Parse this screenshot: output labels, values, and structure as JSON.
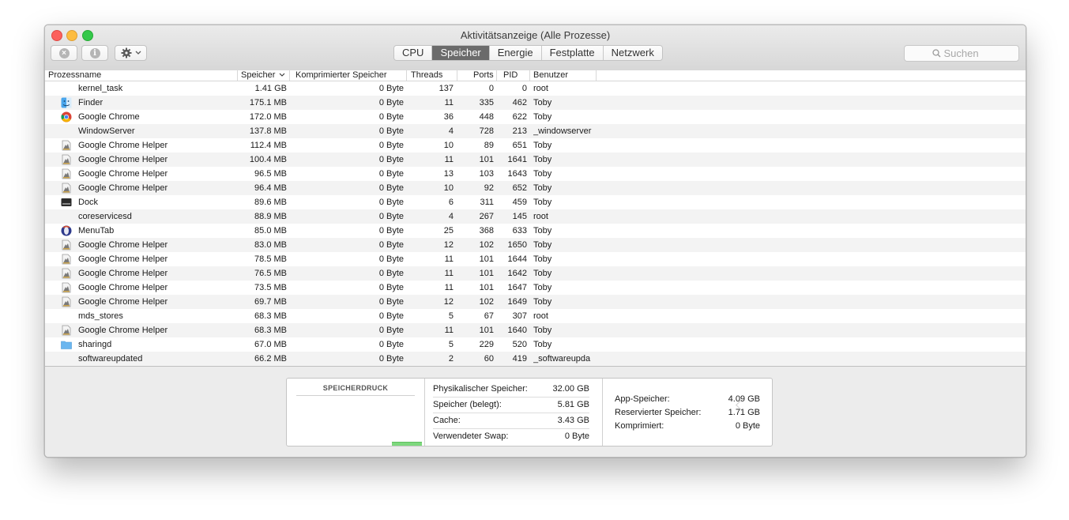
{
  "window": {
    "title": "Aktivitätsanzeige (Alle Prozesse)"
  },
  "toolbar": {
    "stop_icon": "stop-icon",
    "info_icon": "info-icon",
    "gear_icon": "gear-icon",
    "tabs": [
      {
        "label": "CPU",
        "active": false
      },
      {
        "label": "Speicher",
        "active": true
      },
      {
        "label": "Energie",
        "active": false
      },
      {
        "label": "Festplatte",
        "active": false
      },
      {
        "label": "Netzwerk",
        "active": false
      }
    ],
    "search_placeholder": "Suchen"
  },
  "table": {
    "columns": {
      "name": "Prozessname",
      "memory": "Speicher",
      "compressed": "Komprimierter Speicher",
      "threads": "Threads",
      "ports": "Ports",
      "pid": "PID",
      "user": "Benutzer"
    },
    "rows": [
      {
        "name": "kernel_task",
        "memory": "1.41 GB",
        "compressed": "0 Byte",
        "threads": "137",
        "ports": "0",
        "pid": "0",
        "user": "root",
        "icon": "none"
      },
      {
        "name": "Finder",
        "memory": "175.1 MB",
        "compressed": "0 Byte",
        "threads": "11",
        "ports": "335",
        "pid": "462",
        "user": "Toby",
        "icon": "finder"
      },
      {
        "name": "Google Chrome",
        "memory": "172.0 MB",
        "compressed": "0 Byte",
        "threads": "36",
        "ports": "448",
        "pid": "622",
        "user": "Toby",
        "icon": "chrome"
      },
      {
        "name": "WindowServer",
        "memory": "137.8 MB",
        "compressed": "0 Byte",
        "threads": "4",
        "ports": "728",
        "pid": "213",
        "user": "_windowserver",
        "icon": "none"
      },
      {
        "name": "Google Chrome Helper",
        "memory": "112.4 MB",
        "compressed": "0 Byte",
        "threads": "10",
        "ports": "89",
        "pid": "651",
        "user": "Toby",
        "icon": "helper"
      },
      {
        "name": "Google Chrome Helper",
        "memory": "100.4 MB",
        "compressed": "0 Byte",
        "threads": "11",
        "ports": "101",
        "pid": "1641",
        "user": "Toby",
        "icon": "helper"
      },
      {
        "name": "Google Chrome Helper",
        "memory": "96.5 MB",
        "compressed": "0 Byte",
        "threads": "13",
        "ports": "103",
        "pid": "1643",
        "user": "Toby",
        "icon": "helper"
      },
      {
        "name": "Google Chrome Helper",
        "memory": "96.4 MB",
        "compressed": "0 Byte",
        "threads": "10",
        "ports": "92",
        "pid": "652",
        "user": "Toby",
        "icon": "helper"
      },
      {
        "name": "Dock",
        "memory": "89.6 MB",
        "compressed": "0 Byte",
        "threads": "6",
        "ports": "311",
        "pid": "459",
        "user": "Toby",
        "icon": "dock"
      },
      {
        "name": "coreservicesd",
        "memory": "88.9 MB",
        "compressed": "0 Byte",
        "threads": "4",
        "ports": "267",
        "pid": "145",
        "user": "root",
        "icon": "none"
      },
      {
        "name": "MenuTab",
        "memory": "85.0 MB",
        "compressed": "0 Byte",
        "threads": "25",
        "ports": "368",
        "pid": "633",
        "user": "Toby",
        "icon": "menutab"
      },
      {
        "name": "Google Chrome Helper",
        "memory": "83.0 MB",
        "compressed": "0 Byte",
        "threads": "12",
        "ports": "102",
        "pid": "1650",
        "user": "Toby",
        "icon": "helper"
      },
      {
        "name": "Google Chrome Helper",
        "memory": "78.5 MB",
        "compressed": "0 Byte",
        "threads": "11",
        "ports": "101",
        "pid": "1644",
        "user": "Toby",
        "icon": "helper"
      },
      {
        "name": "Google Chrome Helper",
        "memory": "76.5 MB",
        "compressed": "0 Byte",
        "threads": "11",
        "ports": "101",
        "pid": "1642",
        "user": "Toby",
        "icon": "helper"
      },
      {
        "name": "Google Chrome Helper",
        "memory": "73.5 MB",
        "compressed": "0 Byte",
        "threads": "11",
        "ports": "101",
        "pid": "1647",
        "user": "Toby",
        "icon": "helper"
      },
      {
        "name": "Google Chrome Helper",
        "memory": "69.7 MB",
        "compressed": "0 Byte",
        "threads": "12",
        "ports": "102",
        "pid": "1649",
        "user": "Toby",
        "icon": "helper"
      },
      {
        "name": "mds_stores",
        "memory": "68.3 MB",
        "compressed": "0 Byte",
        "threads": "5",
        "ports": "67",
        "pid": "307",
        "user": "root",
        "icon": "none"
      },
      {
        "name": "Google Chrome Helper",
        "memory": "68.3 MB",
        "compressed": "0 Byte",
        "threads": "11",
        "ports": "101",
        "pid": "1640",
        "user": "Toby",
        "icon": "helper"
      },
      {
        "name": "sharingd",
        "memory": "67.0 MB",
        "compressed": "0 Byte",
        "threads": "5",
        "ports": "229",
        "pid": "520",
        "user": "Toby",
        "icon": "folder"
      },
      {
        "name": "softwareupdated",
        "memory": "66.2 MB",
        "compressed": "0 Byte",
        "threads": "2",
        "ports": "60",
        "pid": "419",
        "user": "_softwareupda",
        "icon": "none"
      }
    ]
  },
  "memory_panel": {
    "pressure_title": "SPEICHERDRUCK",
    "pressure_color": "#7dd87d",
    "stats": [
      {
        "label": "Physikalischer Speicher:",
        "value": "32.00 GB"
      },
      {
        "label": "Speicher (belegt):",
        "value": "5.81 GB"
      },
      {
        "label": "Cache:",
        "value": "3.43 GB"
      },
      {
        "label": "Verwendeter Swap:",
        "value": "0 Byte"
      }
    ],
    "breakdown": [
      {
        "label": "App-Speicher:",
        "value": "4.09 GB"
      },
      {
        "label": "Reservierter Speicher:",
        "value": "1.71 GB"
      },
      {
        "label": "Komprimiert:",
        "value": "0 Byte"
      }
    ]
  }
}
